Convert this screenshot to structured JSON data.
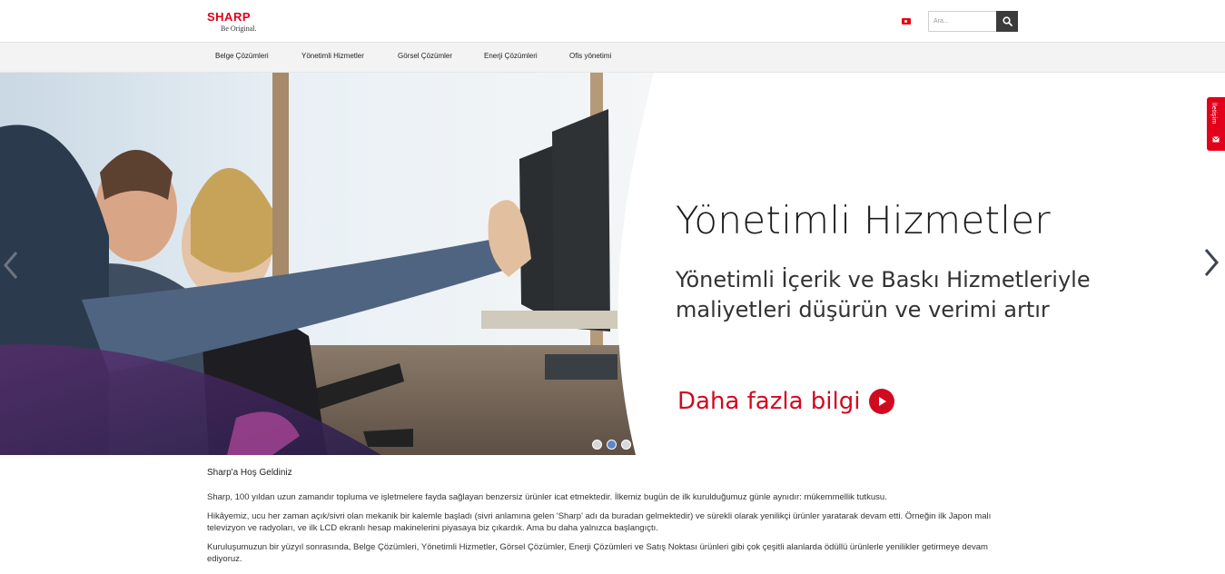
{
  "header": {
    "logo_text": "SHARP",
    "logo_tagline": "Be Original.",
    "language_flag": "turkey-flag",
    "search": {
      "placeholder": "Ara..."
    }
  },
  "nav": {
    "items": [
      {
        "label": "Belge Çözümleri"
      },
      {
        "label": "Yönetimli Hizmetler"
      },
      {
        "label": "Görsel Çözümler"
      },
      {
        "label": "Enerji Çözümleri"
      },
      {
        "label": "Ofis yönetimi"
      }
    ]
  },
  "hero": {
    "title": "Yönetimli Hizmetler",
    "subtitle": "Yönetimli İçerik ve Baskı Hizmetleriyle maliyetleri düşürün ve verimi artır",
    "cta_label": "Daha fazla bilgi",
    "slides_total": 3,
    "active_slide": 2
  },
  "contact_tab": {
    "label": "İletişim",
    "icon": "envelope-icon"
  },
  "welcome": {
    "title": "Sharp'a Hoş Geldiniz",
    "paragraphs": [
      "Sharp, 100 yıldan uzun zamandır topluma ve işletmelere fayda sağlayan benzersiz ürünler icat etmektedir. İlkemiz bugün de ilk kurulduğumuz günle aynıdır: mükemmellik tutkusu.",
      "Hikâyemiz, ucu her zaman açık/sivri olan mekanik bir kalemle başladı (sivri anlamına gelen 'Sharp' adı da buradan gelmektedir) ve sürekli olarak yenilikçi ürünler yaratarak devam etti. Örneğin ilk Japon malı televizyon ve radyoları, ve ilk LCD ekranlı hesap makinelerini piyasaya biz çıkardık. Ama bu daha yalnızca başlangıçtı.",
      "Kuruluşumuzun bir yüzyıl sonrasında, Belge Çözümleri, Yönetimli Hizmetler, Görsel Çözümler, Enerji Çözümleri ve Satış Noktası ürünleri gibi çok çeşitli alanlarda ödüllü ürünlerle yenilikler getirmeye devam ediyoruz."
    ]
  },
  "colors": {
    "brand_red": "#e2001a",
    "cta_red": "#d10a1f",
    "active_dot": "#5b87c7"
  }
}
